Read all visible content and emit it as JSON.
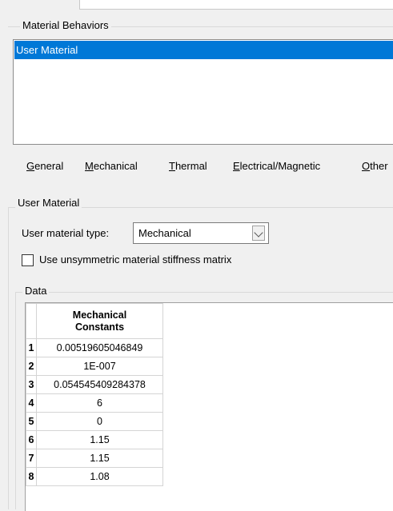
{
  "behaviors": {
    "group_label": "Material Behaviors",
    "items": [
      "User Material"
    ]
  },
  "menu": {
    "items": [
      {
        "mnemonic": "G",
        "rest": "eneral"
      },
      {
        "mnemonic": "M",
        "rest": "echanical"
      },
      {
        "mnemonic": "T",
        "rest": "hermal"
      },
      {
        "mnemonic": "E",
        "rest": "lectrical/Magnetic"
      },
      {
        "mnemonic": "O",
        "rest": "ther"
      }
    ]
  },
  "user_material": {
    "group_label": "User Material",
    "type_label": "User material type:",
    "type_value": "Mechanical",
    "checkbox_label": "Use unsymmetric material stiffness matrix",
    "checkbox_checked": false
  },
  "data_group": {
    "label": "Data",
    "column_header_line1": "Mechanical",
    "column_header_line2": "Constants",
    "rows": [
      {
        "index": "1",
        "value": "0.00519605046849"
      },
      {
        "index": "2",
        "value": "1E-007"
      },
      {
        "index": "3",
        "value": "0.054545409284378"
      },
      {
        "index": "4",
        "value": "6"
      },
      {
        "index": "5",
        "value": "0"
      },
      {
        "index": "6",
        "value": "1.15"
      },
      {
        "index": "7",
        "value": "1.15"
      },
      {
        "index": "8",
        "value": "1.08"
      }
    ]
  }
}
